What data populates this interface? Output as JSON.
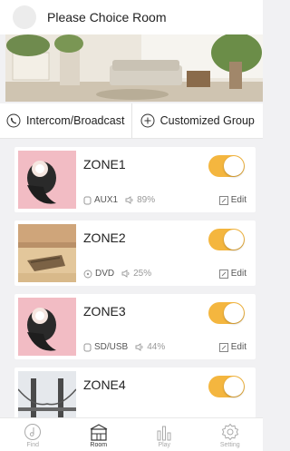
{
  "header": {
    "title": "Please Choice Room"
  },
  "actions": {
    "intercom_label": "Intercom/Broadcast",
    "customized_label": "Customized Group"
  },
  "zones": [
    {
      "name": "ZONE1",
      "source": "AUX1",
      "volume": "89%",
      "edit_label": "Edit",
      "enabled": true
    },
    {
      "name": "ZONE2",
      "source": "DVD",
      "volume": "25%",
      "edit_label": "Edit",
      "enabled": true
    },
    {
      "name": "ZONE3",
      "source": "SD/USB",
      "volume": "44%",
      "edit_label": "Edit",
      "enabled": true
    },
    {
      "name": "ZONE4",
      "enabled": true
    }
  ],
  "tabs": [
    {
      "label": "Find",
      "icon": "music-disc-icon"
    },
    {
      "label": "Room",
      "icon": "room-icon",
      "active": true
    },
    {
      "label": "Play",
      "icon": "equalizer-icon"
    },
    {
      "label": "Setting",
      "icon": "gear-icon"
    }
  ],
  "colors": {
    "accent": "#f4b63f",
    "background": "#f1f1f3"
  }
}
